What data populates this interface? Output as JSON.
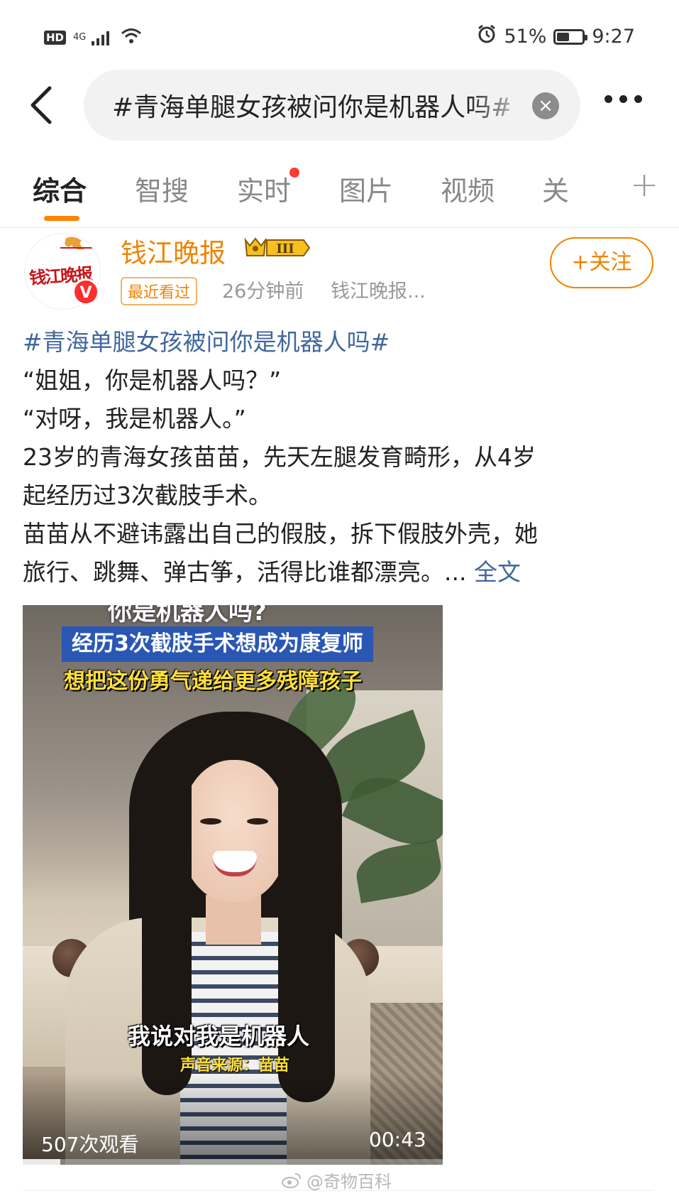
{
  "status_bar": {
    "hd": "HD",
    "network": "4G",
    "battery_percent": "51%",
    "battery_level": 0.51,
    "time": "9:27"
  },
  "search": {
    "query": "#青海单腿女孩被问你是机器人吗#"
  },
  "tabs": [
    {
      "label": "综合",
      "active": true
    },
    {
      "label": "智搜",
      "active": false
    },
    {
      "label": "实时",
      "active": false,
      "has_dot": true
    },
    {
      "label": "图片",
      "active": false
    },
    {
      "label": "视频",
      "active": false
    },
    {
      "label": "关",
      "active": false
    }
  ],
  "post": {
    "author": "钱江晚报",
    "avatar_text": "钱江晚报",
    "verified_badge": "V",
    "vip_level": "III",
    "recent_tag": "最近看过",
    "time": "26分钟前",
    "source": "钱江晚报...",
    "follow_label": "+关注",
    "hashtag": "#青海单腿女孩被问你是机器人吗#",
    "lines": [
      "“姐姐，你是机器人吗？”",
      "“对呀，我是机器人。”",
      "23岁的青海女孩苗苗，先天左腿发育畸形，从4岁",
      "起经历过3次截肢手术。",
      "苗苗从不避讳露出自己的假肢，拆下假肢外壳，她"
    ],
    "last_line": "旅行、跳舞、弹古筝，活得比谁都漂亮。...",
    "full_text_link": "全文",
    "video": {
      "title_top": "你是机器人吗?",
      "banner": "经历3次截肢手术想成为康复师",
      "subtitle": "想把这份勇气递给更多残障孩子",
      "caption": "我说对我是机器人",
      "source": "声音来源：苗苗",
      "views": "507次观看",
      "duration": "00:43",
      "progress": 0.09
    }
  },
  "watermark": "@奇物百科",
  "colors": {
    "accent": "#ff8200",
    "author": "#f08300",
    "link": "#41679c",
    "banner": "#2a57b3",
    "subtitle": "#ffe13b"
  }
}
